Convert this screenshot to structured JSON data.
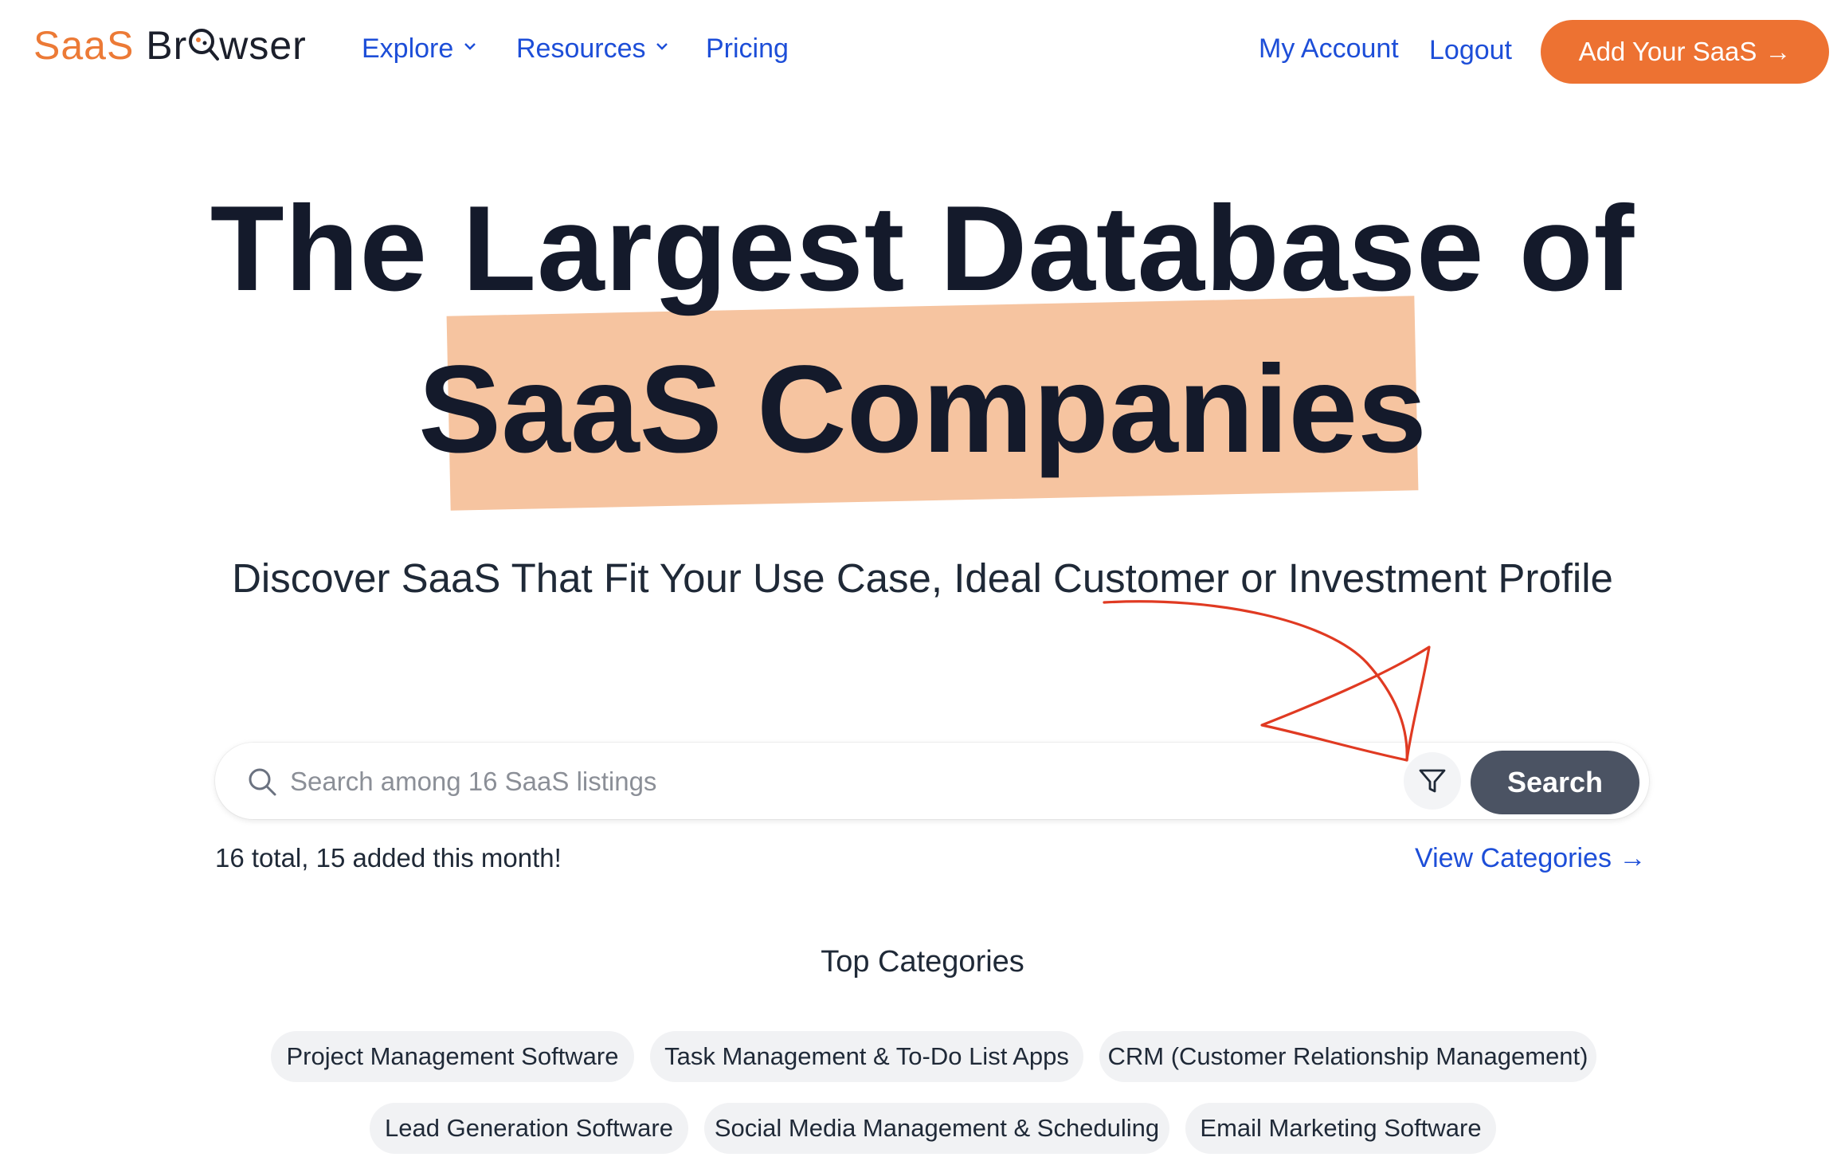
{
  "header": {
    "logo": {
      "part1": "SaaS",
      "part2a": "Br",
      "part2b": "wser"
    },
    "nav": [
      {
        "label": "Explore",
        "has_dropdown": true
      },
      {
        "label": "Resources",
        "has_dropdown": true
      },
      {
        "label": "Pricing",
        "has_dropdown": false
      }
    ],
    "my_account": "My Account",
    "logout": "Logout",
    "cta": {
      "label": "Add Your SaaS",
      "arrow": "→"
    }
  },
  "hero": {
    "line1": "The Largest Database of",
    "line2": "SaaS Companies",
    "subtitle": "Discover SaaS That Fit Your Use Case, Ideal Customer or Investment Profile"
  },
  "search": {
    "placeholder": "Search among 16 SaaS listings",
    "value": "",
    "button": "Search"
  },
  "stats": "16 total, 15 added this month!",
  "view_categories": "View Categories →",
  "top_categories": {
    "title": "Top Categories",
    "items": [
      "Project Management Software",
      "Task Management & To-Do List Apps",
      "CRM (Customer Relationship Management)",
      "Lead Generation Software",
      "Social Media Management & Scheduling",
      "Email Marketing Software"
    ]
  },
  "colors": {
    "brand_orange": "#ED7232",
    "link_blue": "#1D4ED8",
    "highlight": "#F6C4A0",
    "search_button": "#4B5363",
    "annotation_red": "#E03A22"
  }
}
